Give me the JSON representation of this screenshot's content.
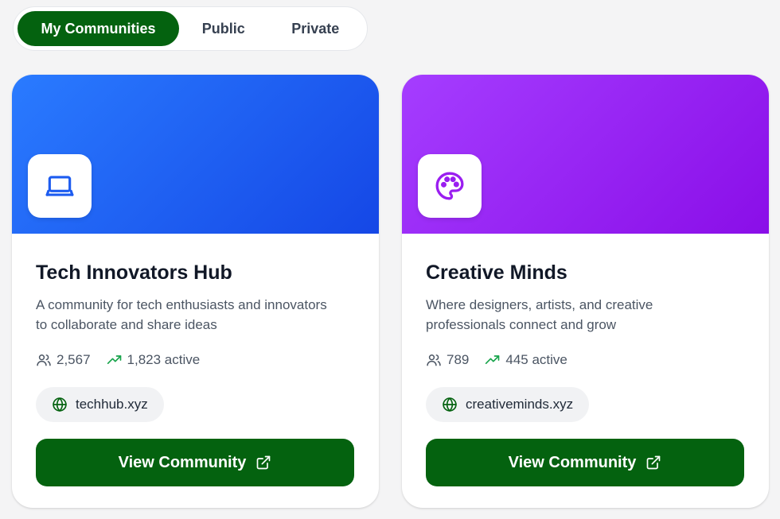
{
  "tabs": [
    {
      "label": "My Communities",
      "active": true
    },
    {
      "label": "Public",
      "active": false
    },
    {
      "label": "Private",
      "active": false
    }
  ],
  "communities": [
    {
      "name": "Tech Innovators Hub",
      "description": "A community for tech enthusiasts and innovators to collaborate and share ideas",
      "members": "2,567",
      "active": "1,823 active",
      "domain": "techhub.xyz",
      "button_label": "View Community",
      "icon": "laptop-icon",
      "gradient": [
        "#2a7bff",
        "#1547e6"
      ],
      "accent": "#1d5cf0"
    },
    {
      "name": "Creative Minds",
      "description": "Where designers, artists, and creative professionals connect and grow",
      "members": "789",
      "active": "445 active",
      "domain": "creativeminds.xyz",
      "button_label": "View Community",
      "icon": "palette-icon",
      "gradient": [
        "#a53dff",
        "#8a0ee8"
      ],
      "accent": "#9a1ef0"
    }
  ],
  "colors": {
    "primary": "#04620f",
    "trend_green": "#16a34a",
    "page_bg": "#f4f4f5"
  }
}
